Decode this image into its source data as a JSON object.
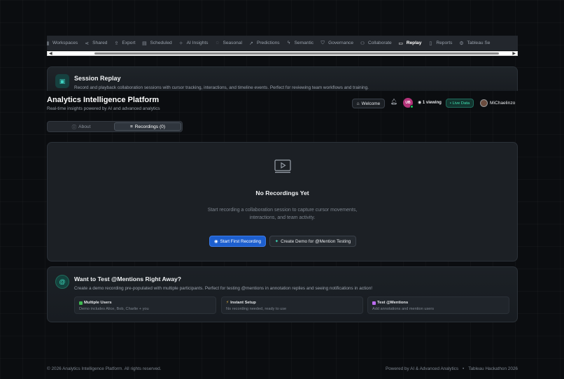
{
  "tabs": [
    {
      "label": "Workspaces",
      "icon": "grid-icon",
      "active": false
    },
    {
      "label": "Shared",
      "icon": "share-icon",
      "active": false
    },
    {
      "label": "Export",
      "icon": "export-icon",
      "active": false
    },
    {
      "label": "Scheduled",
      "icon": "calendar-icon",
      "active": false
    },
    {
      "label": "AI Insights",
      "icon": "sparkle-icon",
      "active": false
    },
    {
      "label": "Seasonal",
      "icon": "seasonal-icon",
      "active": false
    },
    {
      "label": "Predictions",
      "icon": "trend-icon",
      "active": false
    },
    {
      "label": "Semantic",
      "icon": "bolt-icon",
      "active": false
    },
    {
      "label": "Governance",
      "icon": "shield-icon",
      "active": false
    },
    {
      "label": "Collaborate",
      "icon": "users-icon",
      "active": false
    },
    {
      "label": "Replay",
      "icon": "video-icon",
      "active": true
    },
    {
      "label": "Reports",
      "icon": "file-icon",
      "active": false
    },
    {
      "label": "Tableau Se",
      "icon": "gear-icon",
      "active": false
    }
  ],
  "banner": {
    "title": "Session Replay",
    "description": "Record and playback collaboration sessions with cursor tracking, interactions, and timeline events. Perfect for reviewing team workflows and training."
  },
  "header": {
    "title": "Analytics Intelligence Platform",
    "subtitle": "Real-time insights powered by AI and advanced analytics",
    "welcome_label": "Welcome",
    "avatar_initials": "UB",
    "viewing_label": "1 viewing",
    "live_label": "Live Data",
    "username": "MiChaelinzo"
  },
  "segmented": {
    "about_label": "About",
    "recordings_label": "Recordings (0)"
  },
  "empty_state": {
    "title": "No Recordings Yet",
    "description": "Start recording a collaboration session to capture cursor movements, interactions, and team activity.",
    "primary_button": "Start First Recording",
    "secondary_button": "Create Demo for @Mention Testing"
  },
  "mention_card": {
    "title": "Want to Test @Mentions Right Away?",
    "description": "Create a demo recording pre-populated with multiple participants. Perfect for testing @mentions in annotation replies and seeing notifications in action!",
    "features": [
      {
        "title": "Multiple Users",
        "desc": "Demo includes Alice, Bob, Charlie + you",
        "color": "#3fb950"
      },
      {
        "title": "Instant Setup",
        "desc": "No recording needed, ready to use",
        "color": "#e3b341"
      },
      {
        "title": "Test @Mentions",
        "desc": "Add annotations and mention users",
        "color": "#bc6cf0"
      }
    ]
  },
  "footer": {
    "copyright": "© 2026 Analytics Intelligence Platform. All rights reserved.",
    "powered": "Powered by AI & Advanced Analytics",
    "event": "Tableau Hackathon 2026",
    "separator": "•"
  }
}
